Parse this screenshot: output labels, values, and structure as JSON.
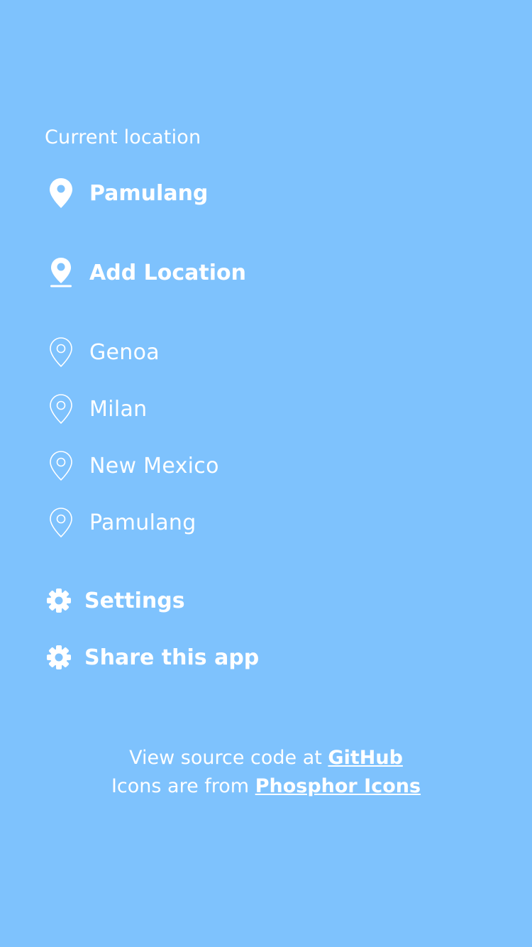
{
  "current_location": {
    "section_label": "Current location",
    "name": "Pamulang",
    "icon": "map-pin-fill-icon"
  },
  "add_location": {
    "label": "Add Location",
    "icon": "map-pin-line-fill-icon"
  },
  "saved_locations": [
    {
      "label": "Genoa",
      "icon": "map-pin-outline-icon"
    },
    {
      "label": "Milan",
      "icon": "map-pin-outline-icon"
    },
    {
      "label": "New Mexico",
      "icon": "map-pin-outline-icon"
    },
    {
      "label": "Pamulang",
      "icon": "map-pin-outline-icon"
    }
  ],
  "actions": [
    {
      "label": "Settings",
      "icon": "gear-icon"
    },
    {
      "label": "Share this app",
      "icon": "gear-icon"
    }
  ],
  "footer": {
    "source_prefix": "View source code at ",
    "source_link": "GitHub",
    "icons_prefix": "Icons are from ",
    "icons_link": "Phosphor Icons"
  },
  "colors": {
    "background": "#7ec2fd",
    "foreground": "#ffffff"
  }
}
